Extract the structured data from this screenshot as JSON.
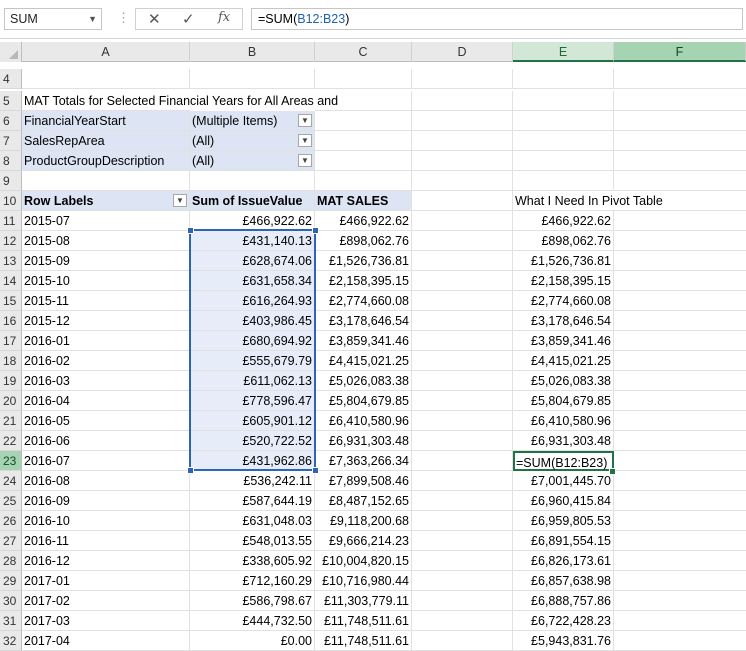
{
  "formula_bar": {
    "name_box": "SUM",
    "formula_prefix": "=SUM(",
    "formula_range": "B12:B23",
    "formula_suffix": ")"
  },
  "columns": [
    "A",
    "B",
    "C",
    "D",
    "E",
    "F"
  ],
  "pivot": {
    "title": "MAT Totals for Selected Financial Years for All Areas and",
    "filters": [
      {
        "row": "6",
        "field": "FinancialYearStart",
        "value": "(Multiple Items)"
      },
      {
        "row": "7",
        "field": "SalesRepArea",
        "value": "(All)"
      },
      {
        "row": "8",
        "field": "ProductGroupDescription",
        "value": "(All)"
      }
    ],
    "header": {
      "row_labels": "Row Labels",
      "sum_issue": "Sum of IssueValue",
      "mat_sales": "MAT SALES"
    },
    "side_header": "What I Need In Pivot Table",
    "rows": [
      {
        "row": "11",
        "label": "2015-07",
        "issue": "£466,922.62",
        "mat": "£466,922.62",
        "need": "£466,922.62"
      },
      {
        "row": "12",
        "label": "2015-08",
        "issue": "£431,140.13",
        "mat": "£898,062.76",
        "need": "£898,062.76"
      },
      {
        "row": "13",
        "label": "2015-09",
        "issue": "£628,674.06",
        "mat": "£1,526,736.81",
        "need": "£1,526,736.81"
      },
      {
        "row": "14",
        "label": "2015-10",
        "issue": "£631,658.34",
        "mat": "£2,158,395.15",
        "need": "£2,158,395.15"
      },
      {
        "row": "15",
        "label": "2015-11",
        "issue": "£616,264.93",
        "mat": "£2,774,660.08",
        "need": "£2,774,660.08"
      },
      {
        "row": "16",
        "label": "2015-12",
        "issue": "£403,986.45",
        "mat": "£3,178,646.54",
        "need": "£3,178,646.54"
      },
      {
        "row": "17",
        "label": "2016-01",
        "issue": "£680,694.92",
        "mat": "£3,859,341.46",
        "need": "£3,859,341.46"
      },
      {
        "row": "18",
        "label": "2016-02",
        "issue": "£555,679.79",
        "mat": "£4,415,021.25",
        "need": "£4,415,021.25"
      },
      {
        "row": "19",
        "label": "2016-03",
        "issue": "£611,062.13",
        "mat": "£5,026,083.38",
        "need": "£5,026,083.38"
      },
      {
        "row": "20",
        "label": "2016-04",
        "issue": "£778,596.47",
        "mat": "£5,804,679.85",
        "need": "£5,804,679.85"
      },
      {
        "row": "21",
        "label": "2016-05",
        "issue": "£605,901.12",
        "mat": "£6,410,580.96",
        "need": "£6,410,580.96"
      },
      {
        "row": "22",
        "label": "2016-06",
        "issue": "£520,722.52",
        "mat": "£6,931,303.48",
        "need": "£6,931,303.48"
      },
      {
        "row": "23",
        "label": "2016-07",
        "issue": "£431,962.86",
        "mat": "£7,363,266.34",
        "need": "=SUM(B12:B23)"
      },
      {
        "row": "24",
        "label": "2016-08",
        "issue": "£536,242.11",
        "mat": "£7,899,508.46",
        "need": "£7,001,445.70"
      },
      {
        "row": "25",
        "label": "2016-09",
        "issue": "£587,644.19",
        "mat": "£8,487,152.65",
        "need": "£6,960,415.84"
      },
      {
        "row": "26",
        "label": "2016-10",
        "issue": "£631,048.03",
        "mat": "£9,118,200.68",
        "need": "£6,959,805.53"
      },
      {
        "row": "27",
        "label": "2016-11",
        "issue": "£548,013.55",
        "mat": "£9,666,214.23",
        "need": "£6,891,554.15"
      },
      {
        "row": "28",
        "label": "2016-12",
        "issue": "£338,605.92",
        "mat": "£10,004,820.15",
        "need": "£6,826,173.61"
      },
      {
        "row": "29",
        "label": "2017-01",
        "issue": "£712,160.29",
        "mat": "£10,716,980.44",
        "need": "£6,857,638.98"
      },
      {
        "row": "30",
        "label": "2017-02",
        "issue": "£586,798.67",
        "mat": "£11,303,779.11",
        "need": "£6,888,757.86"
      },
      {
        "row": "31",
        "label": "2017-03",
        "issue": "£444,732.50",
        "mat": "£11,748,511.61",
        "need": "£6,722,428.23"
      },
      {
        "row": "32",
        "label": "2017-04",
        "issue": "£0.00",
        "mat": "£11,748,511.61",
        "need": "£5,943,831.76"
      }
    ]
  },
  "colors": {
    "accent_green": "#217346",
    "selection_blue": "#2f63b8",
    "pivot_header": "#dde4f3"
  }
}
